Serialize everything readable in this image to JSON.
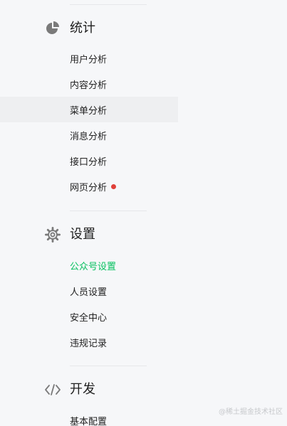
{
  "sections": [
    {
      "title": "统计",
      "icon": "pie-chart-icon",
      "items": [
        {
          "label": "用户分析"
        },
        {
          "label": "内容分析"
        },
        {
          "label": "菜单分析",
          "highlighted": true
        },
        {
          "label": "消息分析"
        },
        {
          "label": "接口分析"
        },
        {
          "label": "网页分析",
          "badge": "red-dot"
        }
      ]
    },
    {
      "title": "设置",
      "icon": "gear-icon",
      "items": [
        {
          "label": "公众号设置",
          "active": true
        },
        {
          "label": "人员设置"
        },
        {
          "label": "安全中心"
        },
        {
          "label": "违规记录"
        }
      ]
    },
    {
      "title": "开发",
      "icon": "code-icon",
      "items": [
        {
          "label": "基本配置"
        }
      ]
    }
  ],
  "watermark": "@稀土掘金技术社区",
  "colors": {
    "active": "#07c160",
    "badge": "#e0403a",
    "background": "#f6f7f9",
    "hover": "#eeeff1"
  }
}
